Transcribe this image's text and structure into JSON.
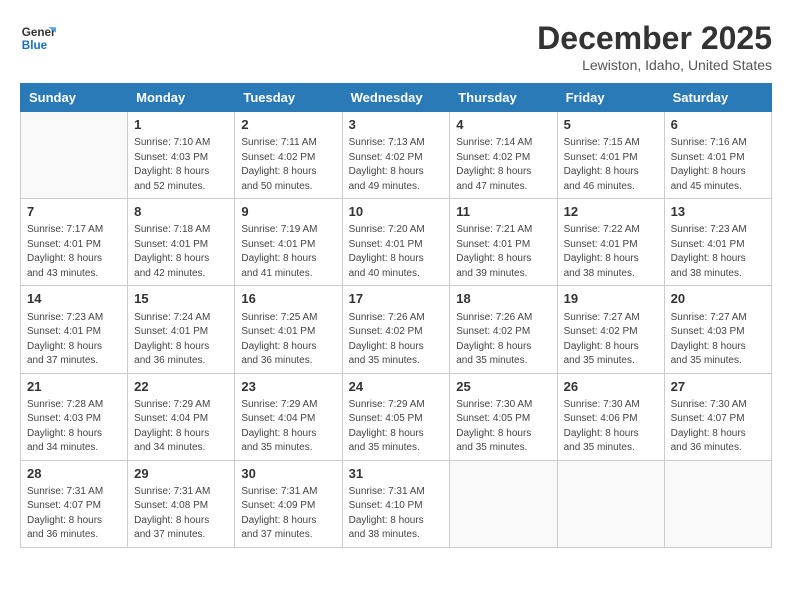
{
  "header": {
    "logo_line1": "General",
    "logo_line2": "Blue",
    "month": "December 2025",
    "location": "Lewiston, Idaho, United States"
  },
  "weekdays": [
    "Sunday",
    "Monday",
    "Tuesday",
    "Wednesday",
    "Thursday",
    "Friday",
    "Saturday"
  ],
  "weeks": [
    [
      {
        "day": "",
        "info": ""
      },
      {
        "day": "1",
        "info": "Sunrise: 7:10 AM\nSunset: 4:03 PM\nDaylight: 8 hours\nand 52 minutes."
      },
      {
        "day": "2",
        "info": "Sunrise: 7:11 AM\nSunset: 4:02 PM\nDaylight: 8 hours\nand 50 minutes."
      },
      {
        "day": "3",
        "info": "Sunrise: 7:13 AM\nSunset: 4:02 PM\nDaylight: 8 hours\nand 49 minutes."
      },
      {
        "day": "4",
        "info": "Sunrise: 7:14 AM\nSunset: 4:02 PM\nDaylight: 8 hours\nand 47 minutes."
      },
      {
        "day": "5",
        "info": "Sunrise: 7:15 AM\nSunset: 4:01 PM\nDaylight: 8 hours\nand 46 minutes."
      },
      {
        "day": "6",
        "info": "Sunrise: 7:16 AM\nSunset: 4:01 PM\nDaylight: 8 hours\nand 45 minutes."
      }
    ],
    [
      {
        "day": "7",
        "info": "Sunrise: 7:17 AM\nSunset: 4:01 PM\nDaylight: 8 hours\nand 43 minutes."
      },
      {
        "day": "8",
        "info": "Sunrise: 7:18 AM\nSunset: 4:01 PM\nDaylight: 8 hours\nand 42 minutes."
      },
      {
        "day": "9",
        "info": "Sunrise: 7:19 AM\nSunset: 4:01 PM\nDaylight: 8 hours\nand 41 minutes."
      },
      {
        "day": "10",
        "info": "Sunrise: 7:20 AM\nSunset: 4:01 PM\nDaylight: 8 hours\nand 40 minutes."
      },
      {
        "day": "11",
        "info": "Sunrise: 7:21 AM\nSunset: 4:01 PM\nDaylight: 8 hours\nand 39 minutes."
      },
      {
        "day": "12",
        "info": "Sunrise: 7:22 AM\nSunset: 4:01 PM\nDaylight: 8 hours\nand 38 minutes."
      },
      {
        "day": "13",
        "info": "Sunrise: 7:23 AM\nSunset: 4:01 PM\nDaylight: 8 hours\nand 38 minutes."
      }
    ],
    [
      {
        "day": "14",
        "info": "Sunrise: 7:23 AM\nSunset: 4:01 PM\nDaylight: 8 hours\nand 37 minutes."
      },
      {
        "day": "15",
        "info": "Sunrise: 7:24 AM\nSunset: 4:01 PM\nDaylight: 8 hours\nand 36 minutes."
      },
      {
        "day": "16",
        "info": "Sunrise: 7:25 AM\nSunset: 4:01 PM\nDaylight: 8 hours\nand 36 minutes."
      },
      {
        "day": "17",
        "info": "Sunrise: 7:26 AM\nSunset: 4:02 PM\nDaylight: 8 hours\nand 35 minutes."
      },
      {
        "day": "18",
        "info": "Sunrise: 7:26 AM\nSunset: 4:02 PM\nDaylight: 8 hours\nand 35 minutes."
      },
      {
        "day": "19",
        "info": "Sunrise: 7:27 AM\nSunset: 4:02 PM\nDaylight: 8 hours\nand 35 minutes."
      },
      {
        "day": "20",
        "info": "Sunrise: 7:27 AM\nSunset: 4:03 PM\nDaylight: 8 hours\nand 35 minutes."
      }
    ],
    [
      {
        "day": "21",
        "info": "Sunrise: 7:28 AM\nSunset: 4:03 PM\nDaylight: 8 hours\nand 34 minutes."
      },
      {
        "day": "22",
        "info": "Sunrise: 7:29 AM\nSunset: 4:04 PM\nDaylight: 8 hours\nand 34 minutes."
      },
      {
        "day": "23",
        "info": "Sunrise: 7:29 AM\nSunset: 4:04 PM\nDaylight: 8 hours\nand 35 minutes."
      },
      {
        "day": "24",
        "info": "Sunrise: 7:29 AM\nSunset: 4:05 PM\nDaylight: 8 hours\nand 35 minutes."
      },
      {
        "day": "25",
        "info": "Sunrise: 7:30 AM\nSunset: 4:05 PM\nDaylight: 8 hours\nand 35 minutes."
      },
      {
        "day": "26",
        "info": "Sunrise: 7:30 AM\nSunset: 4:06 PM\nDaylight: 8 hours\nand 35 minutes."
      },
      {
        "day": "27",
        "info": "Sunrise: 7:30 AM\nSunset: 4:07 PM\nDaylight: 8 hours\nand 36 minutes."
      }
    ],
    [
      {
        "day": "28",
        "info": "Sunrise: 7:31 AM\nSunset: 4:07 PM\nDaylight: 8 hours\nand 36 minutes."
      },
      {
        "day": "29",
        "info": "Sunrise: 7:31 AM\nSunset: 4:08 PM\nDaylight: 8 hours\nand 37 minutes."
      },
      {
        "day": "30",
        "info": "Sunrise: 7:31 AM\nSunset: 4:09 PM\nDaylight: 8 hours\nand 37 minutes."
      },
      {
        "day": "31",
        "info": "Sunrise: 7:31 AM\nSunset: 4:10 PM\nDaylight: 8 hours\nand 38 minutes."
      },
      {
        "day": "",
        "info": ""
      },
      {
        "day": "",
        "info": ""
      },
      {
        "day": "",
        "info": ""
      }
    ]
  ]
}
